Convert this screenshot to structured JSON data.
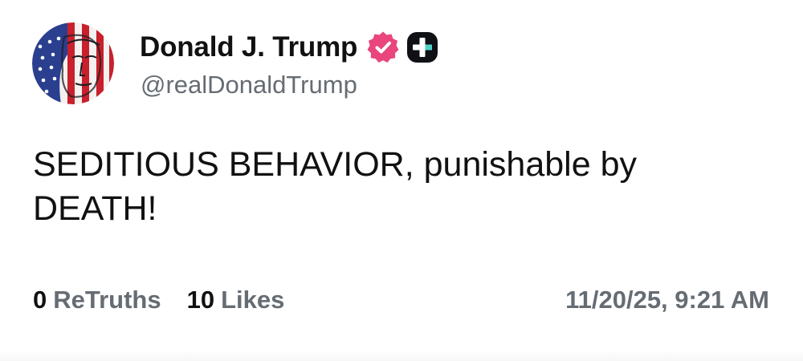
{
  "post": {
    "author": {
      "display_name": "Donald J. Trump",
      "handle": "@realDonaldTrump",
      "avatar_icon": "flag-portrait-avatar",
      "verified_icon": "verified-badge-icon",
      "verified_color": "#e8467c",
      "plus_icon": "plus-badge-icon"
    },
    "text_line1": "SEDITIOUS BEHAVIOR, punishable by",
    "text_line2": "DEATH!",
    "stats": {
      "retruths_count": "0",
      "retruths_label": "ReTruths",
      "likes_count": "10",
      "likes_label": "Likes"
    },
    "timestamp": "11/20/25, 9:21 AM"
  }
}
